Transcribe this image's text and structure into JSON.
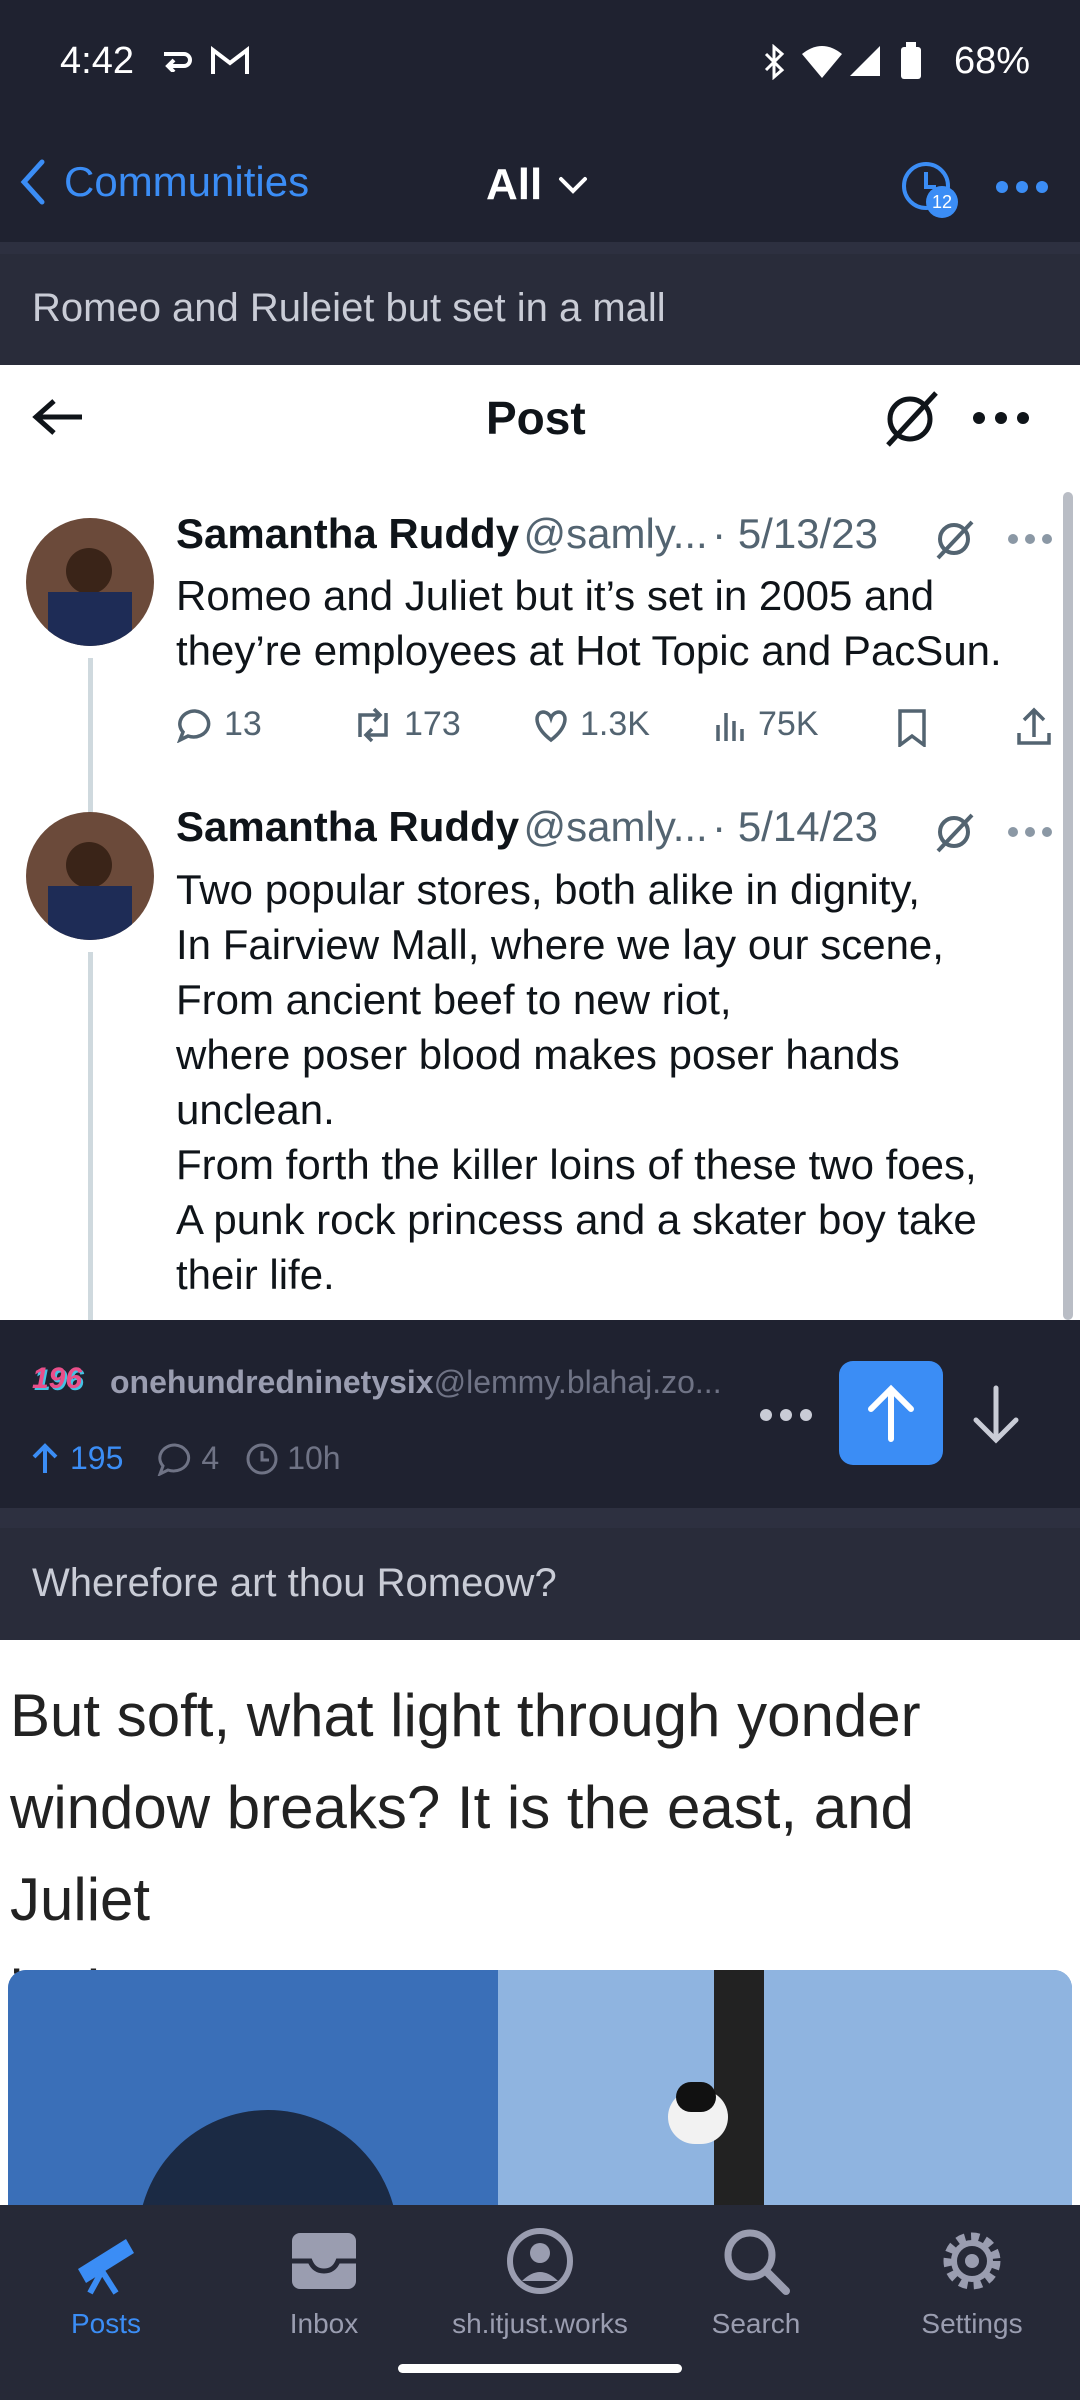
{
  "status_bar": {
    "time": "4:42",
    "battery": "68%"
  },
  "app_bar": {
    "back_label": "Communities",
    "feed_selector": "All",
    "notification_count": "12"
  },
  "posts": [
    {
      "title": "Romeo and Ruleiet but set in a mall",
      "screenshot": {
        "header_title": "Post",
        "tweets": [
          {
            "name": "Samantha Ruddy",
            "handle": "@samly...",
            "date": "· 5/13/23",
            "lines": [
              "Romeo and Juliet but it’s set in 2005 and",
              "they’re employees at Hot Topic and PacSun."
            ],
            "metrics": {
              "replies": "13",
              "retweets": "173",
              "likes": "1.3K",
              "views": "75K"
            }
          },
          {
            "name": "Samantha Ruddy",
            "handle": "@samly...",
            "date": "· 5/14/23",
            "lines": [
              "Two popular stores, both alike in dignity,",
              "In Fairview Mall, where we lay our scene,",
              "From ancient beef to new riot,",
              "where poser blood makes poser hands",
              "unclean.",
              "From forth the killer loins of these two foes,",
              "A punk rock princess and a skater boy take",
              "their life."
            ]
          }
        ]
      },
      "author": "onehundredninetysix",
      "instance": "@lemmy.blahaj.zo...",
      "avatar_text": "196",
      "score": "195",
      "comments": "4",
      "age": "10h"
    },
    {
      "title": "Wherefore art thou Romeow?",
      "image_quote_lines": [
        "But soft, what light through yonder",
        "window breaks? It is the east, and Juliet",
        "is the sun."
      ]
    }
  ],
  "bottom_nav": [
    {
      "label": "Posts",
      "icon": "telescope-icon",
      "active": true
    },
    {
      "label": "Inbox",
      "icon": "inbox-icon",
      "active": false
    },
    {
      "label": "sh.itjust.works",
      "icon": "account-icon",
      "active": false
    },
    {
      "label": "Search",
      "icon": "search-icon",
      "active": false
    },
    {
      "label": "Settings",
      "icon": "gear-icon",
      "active": false
    }
  ],
  "colors": {
    "accent": "#3b8df5",
    "background": "#1f2230",
    "surface": "#292c3a"
  }
}
